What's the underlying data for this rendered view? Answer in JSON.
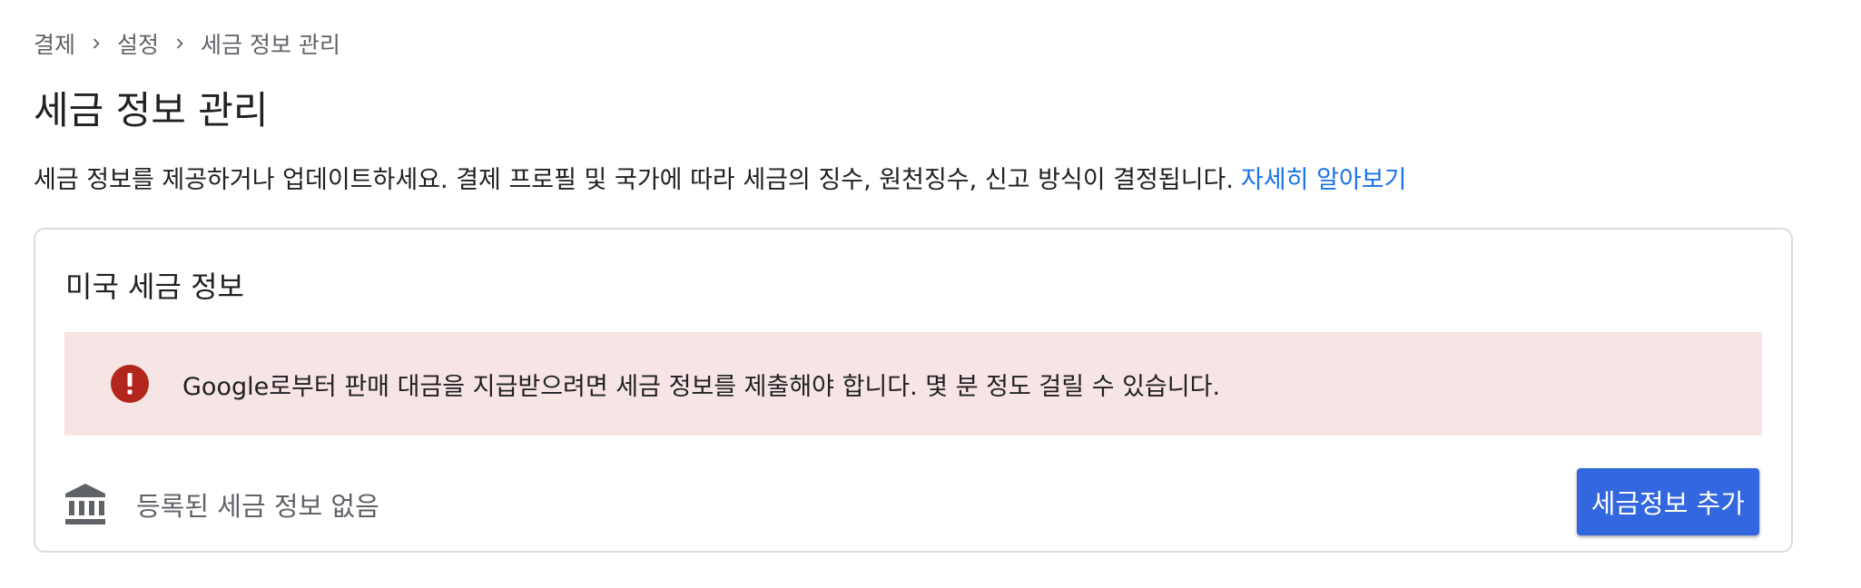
{
  "breadcrumb": {
    "items": [
      "결제",
      "설정",
      "세금 정보 관리"
    ]
  },
  "page": {
    "title": "세금 정보 관리",
    "description": "세금 정보를 제공하거나 업데이트하세요. 결제 프로필 및 국가에 따라 세금의 징수, 원천징수, 신고 방식이 결정됩니다.",
    "learn_more": "자세히 알아보기"
  },
  "card": {
    "title": "미국 세금 정보",
    "alert": {
      "icon": "error-icon",
      "text": "Google로부터 판매 대금을 지급받으려면 세금 정보를 제출해야 합니다. 몇 분 정도 걸릴 수 있습니다."
    },
    "empty": {
      "icon": "bank-icon",
      "text": "등록된 세금 정보 없음"
    },
    "add_button": "세금정보 추가"
  },
  "colors": {
    "accent": "#3367e0",
    "link": "#1a73e8",
    "alert_bg": "#f6e5e4",
    "alert_icon": "#b3261e",
    "border": "#dadce0"
  }
}
